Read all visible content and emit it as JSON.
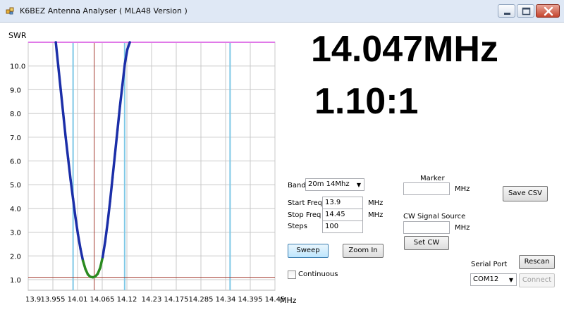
{
  "window": {
    "title": "K6BEZ Antenna Analyser ( MLA48 Version )"
  },
  "readout": {
    "frequency": "14.047MHz",
    "swr": "1.10:1"
  },
  "controls": {
    "band_label": "Band",
    "band_value": "20m  14Mhz",
    "start_freq_label": "Start Freq",
    "start_freq_value": "13.9",
    "stop_freq_label": "Stop Freq",
    "stop_freq_value": "14.45",
    "steps_label": "Steps",
    "steps_value": "100",
    "mhz_unit": "MHz",
    "sweep_button": "Sweep",
    "zoom_in_button": "Zoom In",
    "continuous_label": "Continuous",
    "continuous_checked": false,
    "marker_label": "Marker",
    "marker_value": "",
    "cw_source_label": "CW Signal Source",
    "cw_value": "",
    "set_cw_button": "Set CW",
    "save_csv_button": "Save CSV",
    "serial_port_label": "Serial Port",
    "serial_port_value": "COM12",
    "rescan_button": "Rescan",
    "connect_button": "Connect"
  },
  "chart_data": {
    "type": "line",
    "ylabel": "SWR",
    "xlabel": "MHz",
    "xlim": [
      13.9,
      14.45
    ],
    "ylim": [
      1.0,
      10.5
    ],
    "x_ticks": [
      "13.9",
      "13.955",
      "14.01",
      "14.065",
      "14.12",
      "14.23",
      "14.175",
      "14.285",
      "14.34",
      "14.395",
      "14.45"
    ],
    "y_ticks": [
      "1.0",
      "2.0",
      "3.0",
      "4.0",
      "5.0",
      "6.0",
      "7.0",
      "8.0",
      "9.0",
      "10.0"
    ],
    "grid": true,
    "marker_freq": 14.047,
    "band_edges": [
      14.0,
      14.35
    ],
    "band_edge_secondary": [
      14.115
    ],
    "min_swr_line": 1.1,
    "max_swr_line": 11.0,
    "colors": {
      "curve": "#1b2ea8",
      "curve_low": "#2a8a1f",
      "marker": "#a33a2e",
      "band_edges": "#7fc8e6",
      "max_line": "#e07ae8",
      "grid": "#c8c8c8"
    },
    "series": [
      {
        "x": [
          13.9615,
          13.967,
          13.9725,
          13.978,
          13.9835,
          13.989,
          13.9945,
          14.0,
          14.0055,
          14.011,
          14.0165,
          14.022,
          14.0275,
          14.033,
          14.0385,
          14.044,
          14.0495,
          14.055,
          14.0605,
          14.066,
          14.0715,
          14.077,
          14.0825,
          14.088,
          14.0935,
          14.099,
          14.1045,
          14.11,
          14.1155,
          14.121,
          14.1265
        ],
        "values": [
          11.0,
          10.0,
          9.0,
          8.0,
          7.0,
          6.1,
          5.2,
          4.4,
          3.6,
          2.9,
          2.3,
          1.8,
          1.45,
          1.22,
          1.12,
          1.1,
          1.13,
          1.25,
          1.5,
          1.95,
          2.6,
          3.4,
          4.3,
          5.3,
          6.3,
          7.3,
          8.3,
          9.2,
          10.1,
          10.7,
          11.0
        ]
      }
    ]
  }
}
